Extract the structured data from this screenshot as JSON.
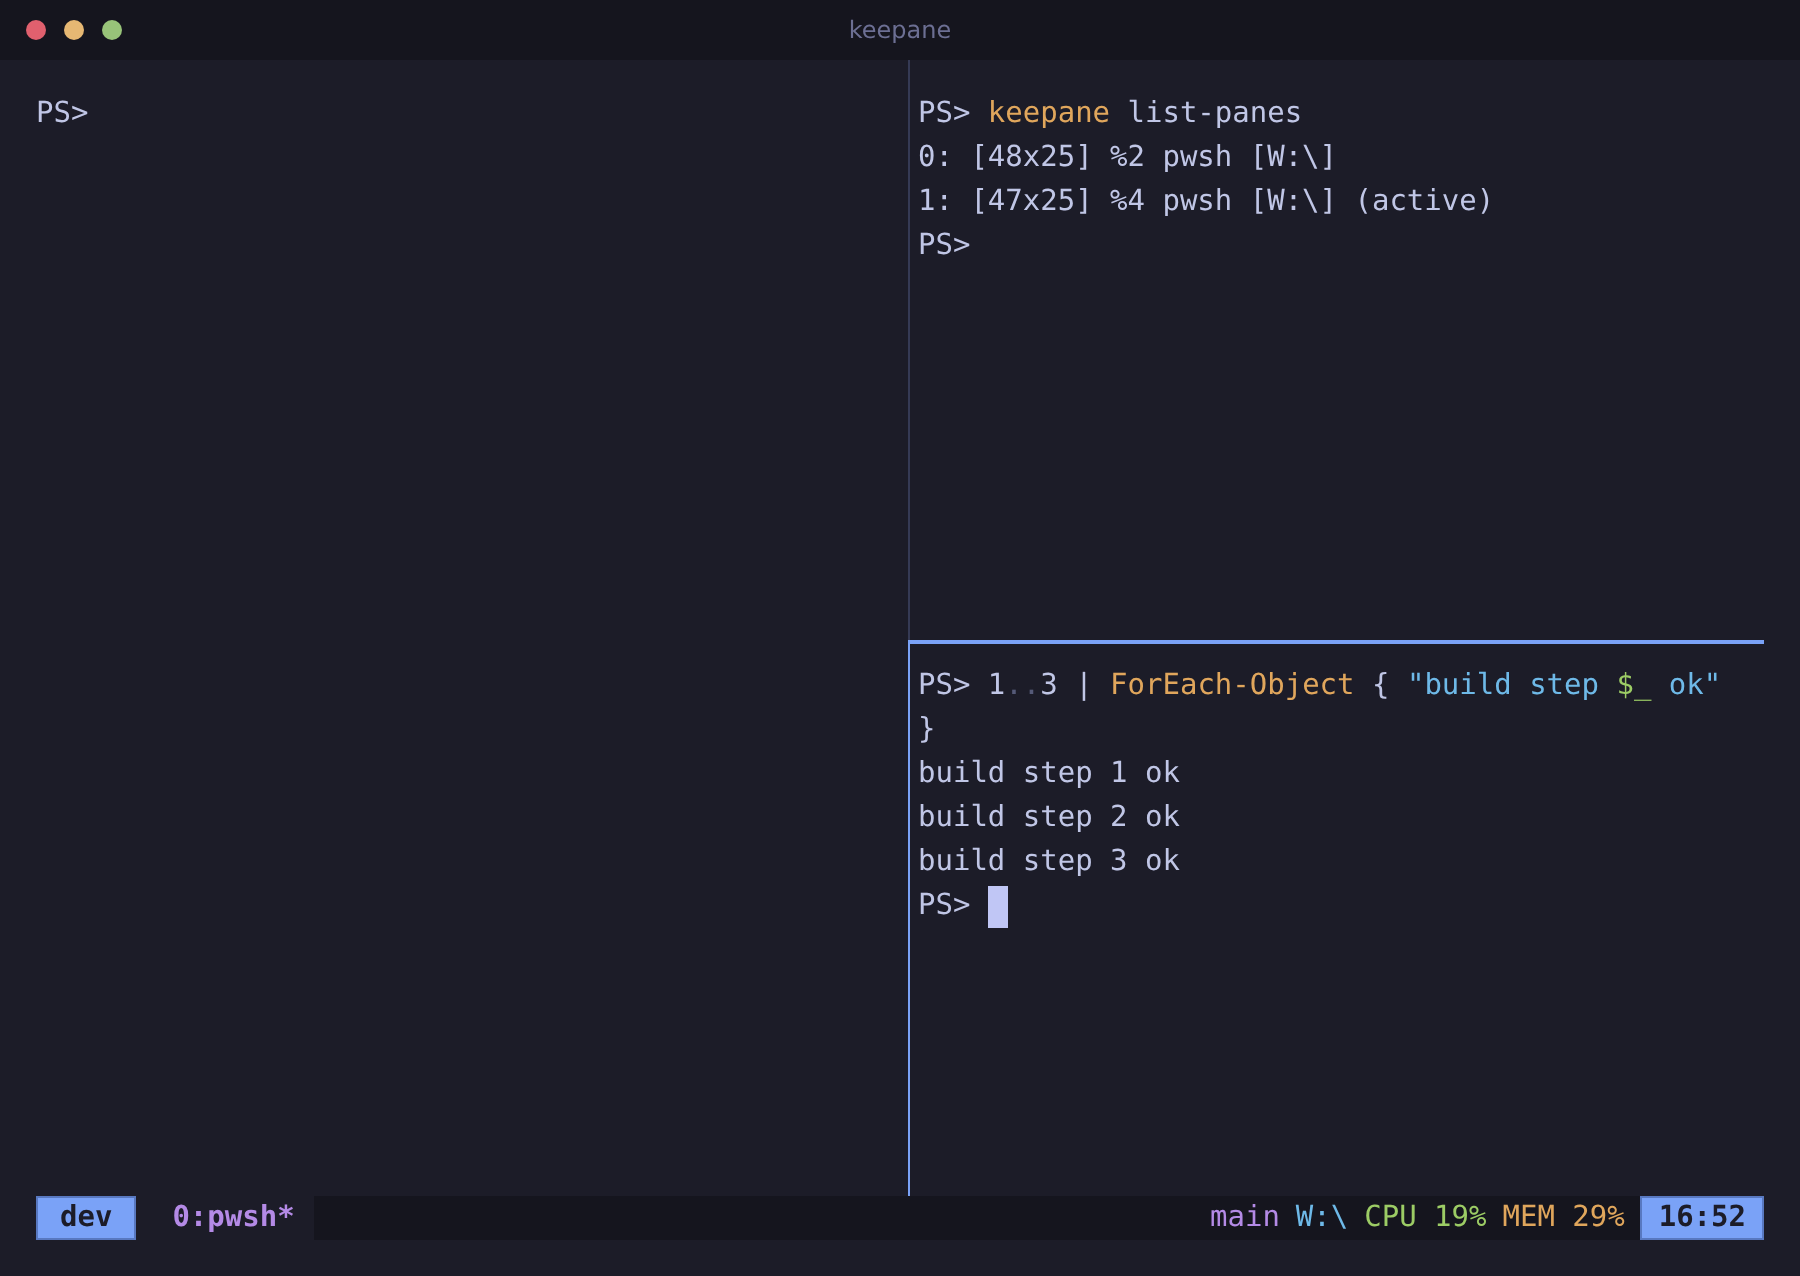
{
  "window": {
    "title": "keepane"
  },
  "panes": [
    {
      "active": false,
      "cursor": false,
      "lines": [
        [
          {
            "kind": "prompt",
            "text": "PS>"
          }
        ]
      ]
    },
    {
      "active": false,
      "cursor": false,
      "lines": [
        [
          {
            "kind": "prompt",
            "text": "PS> "
          },
          {
            "kind": "command",
            "text": "keepane"
          },
          {
            "kind": "plain",
            "text": " list-panes"
          }
        ],
        [
          {
            "kind": "plain",
            "text": "0: [48x25] %2 pwsh [W:\\]"
          }
        ],
        [
          {
            "kind": "plain",
            "text": "1: [47x25] %4 pwsh [W:\\] (active)"
          }
        ],
        [
          {
            "kind": "prompt",
            "text": "PS>"
          }
        ]
      ]
    },
    {
      "active": true,
      "cursor": true,
      "lines": [
        [
          {
            "kind": "prompt",
            "text": "PS> "
          },
          {
            "kind": "plain",
            "text": "1"
          },
          {
            "kind": "dim",
            "text": ".."
          },
          {
            "kind": "plain",
            "text": "3 | "
          },
          {
            "kind": "command",
            "text": "ForEach-Object"
          },
          {
            "kind": "plain",
            "text": " { "
          },
          {
            "kind": "string",
            "text": "\"build step "
          },
          {
            "kind": "variable",
            "text": "$_"
          },
          {
            "kind": "string",
            "text": " ok\""
          }
        ],
        [
          {
            "kind": "plain",
            "text": "}"
          }
        ],
        [
          {
            "kind": "plain",
            "text": "build step 1 ok"
          }
        ],
        [
          {
            "kind": "plain",
            "text": "build step 2 ok"
          }
        ],
        [
          {
            "kind": "plain",
            "text": "build step 3 ok"
          }
        ],
        [
          {
            "kind": "prompt",
            "text": "PS> "
          }
        ]
      ]
    }
  ],
  "status_bar": {
    "session": "dev",
    "window": "0:pwsh*",
    "items": [
      {
        "text": "main",
        "color": "#b48ae6"
      },
      {
        "text": "W:\\",
        "color": "#6eb9e8"
      },
      {
        "text": "CPU 19%",
        "color": "#9ccc65"
      },
      {
        "text": "MEM 29%",
        "color": "#e0a65c"
      }
    ],
    "time": "16:52"
  }
}
